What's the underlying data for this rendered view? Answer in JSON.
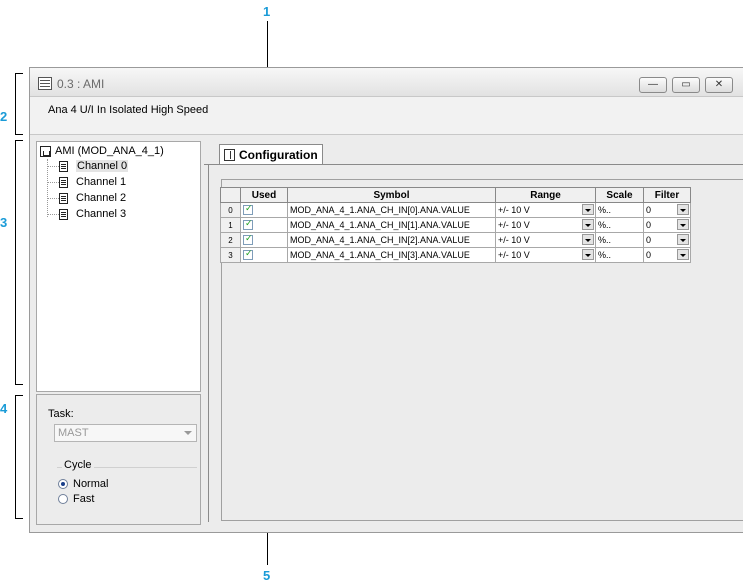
{
  "callouts": [
    "1",
    "2",
    "3",
    "4",
    "5"
  ],
  "window": {
    "title": "0.3 : AMI",
    "subtitle": "Ana 4 U/I In Isolated High Speed",
    "buttons": {
      "minimize": "—",
      "restore": "▭",
      "close": "✕"
    }
  },
  "tree": {
    "root": "AMI (MOD_ANA_4_1)",
    "items": [
      {
        "label": "Channel 0",
        "selected": true
      },
      {
        "label": "Channel 1"
      },
      {
        "label": "Channel 2"
      },
      {
        "label": "Channel 3"
      }
    ]
  },
  "task": {
    "label": "Task:",
    "value": "MAST",
    "cycle_label": "Cycle",
    "options": [
      {
        "label": "Normal",
        "selected": true
      },
      {
        "label": "Fast",
        "selected": false
      }
    ]
  },
  "config": {
    "tab_label": "Configuration",
    "columns": {
      "used": "Used",
      "symbol": "Symbol",
      "range": "Range",
      "scale": "Scale",
      "filter": "Filter"
    },
    "rows": [
      {
        "index": "0",
        "used": true,
        "symbol": "MOD_ANA_4_1.ANA_CH_IN[0].ANA.VALUE",
        "range": "+/- 10 V",
        "scale": "%..",
        "filter": "0"
      },
      {
        "index": "1",
        "used": true,
        "symbol": "MOD_ANA_4_1.ANA_CH_IN[1].ANA.VALUE",
        "range": "+/- 10 V",
        "scale": "%..",
        "filter": "0"
      },
      {
        "index": "2",
        "used": true,
        "symbol": "MOD_ANA_4_1.ANA_CH_IN[2].ANA.VALUE",
        "range": "+/- 10 V",
        "scale": "%..",
        "filter": "0"
      },
      {
        "index": "3",
        "used": true,
        "symbol": "MOD_ANA_4_1.ANA_CH_IN[3].ANA.VALUE",
        "range": "+/- 10 V",
        "scale": "%..",
        "filter": "0"
      }
    ]
  },
  "colors": {
    "callout": "#1a9bd7",
    "checkmark": "#21a121"
  }
}
